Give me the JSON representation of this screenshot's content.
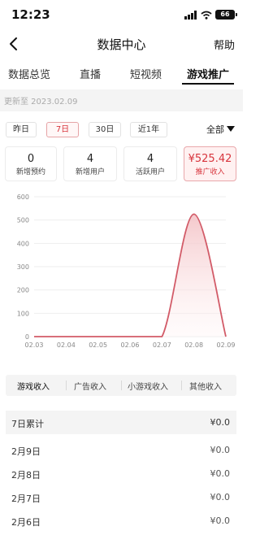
{
  "status_bar": {
    "time": "12:23",
    "battery": "66"
  },
  "nav": {
    "title": "数据中心",
    "help_label": "帮助"
  },
  "tabs": [
    {
      "label": "数据总览",
      "active": false
    },
    {
      "label": "直播",
      "active": false
    },
    {
      "label": "短视频",
      "active": false
    },
    {
      "label": "游戏推广",
      "active": true
    }
  ],
  "update_text": "更新至 2023.02.09",
  "periods": [
    {
      "label": "昨日",
      "active": false
    },
    {
      "label": "7日",
      "active": true
    },
    {
      "label": "30日",
      "active": false
    },
    {
      "label": "近1年",
      "active": false
    }
  ],
  "filter": {
    "label": "全部"
  },
  "kpis": [
    {
      "value": "0",
      "label": "新增预约"
    },
    {
      "value": "4",
      "label": "新增用户"
    },
    {
      "value": "4",
      "label": "活跃用户"
    },
    {
      "value": "¥525.42",
      "label": "推广收入"
    }
  ],
  "chart_data": {
    "type": "area",
    "x": [
      "02.03",
      "02.04",
      "02.05",
      "02.06",
      "02.07",
      "02.08",
      "02.09"
    ],
    "y": [
      0,
      0,
      0,
      0,
      0,
      525.42,
      0
    ],
    "yticks": [
      0,
      100,
      200,
      300,
      400,
      500,
      600
    ],
    "ylim": [
      0,
      600
    ],
    "grid": true,
    "color": "#d25b68"
  },
  "revenue_tabs": [
    {
      "label": "游戏收入",
      "active": true
    },
    {
      "label": "广告收入",
      "active": false
    },
    {
      "label": "小游戏收入",
      "active": false
    },
    {
      "label": "其他收入",
      "active": false
    }
  ],
  "summary": {
    "label": "7日累计",
    "value": "¥0.0"
  },
  "daily_rows": [
    {
      "date": "2月9日",
      "value": "¥0.0"
    },
    {
      "date": "2月8日",
      "value": "¥0.0"
    },
    {
      "date": "2月7日",
      "value": "¥0.0"
    },
    {
      "date": "2月6日",
      "value": "¥0.0"
    }
  ]
}
